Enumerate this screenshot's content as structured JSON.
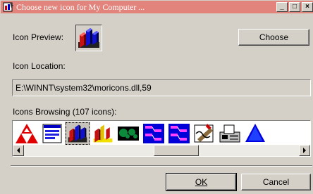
{
  "window": {
    "title": "Choose new icon for My Computer ...",
    "minimize_label": "_",
    "maximize_label": "□",
    "close_label": "×"
  },
  "preview": {
    "label": "Icon Preview:",
    "choose_button": "Choose"
  },
  "location": {
    "label": "Icon Location:",
    "value": "E:\\WINNT\\system32\\moricons.dll,59"
  },
  "browsing": {
    "label": "Icons Browsing (107 icons):",
    "icons": [
      "warning-triangles-icon",
      "screen-window-icon",
      "bar-chart-icon",
      "bar-chart-yellow-icon",
      "world-map-icon",
      "network-diagram-icon",
      "network-diagram-icon",
      "hand-writing-icon",
      "fax-machine-icon",
      "blue-triangle-icon"
    ],
    "selected_index": 2
  },
  "footer": {
    "ok_label": "OK",
    "cancel_label": "Cancel"
  },
  "colors": {
    "titlebar": "#e2837c",
    "dialog_face": "#d4d0c8"
  }
}
